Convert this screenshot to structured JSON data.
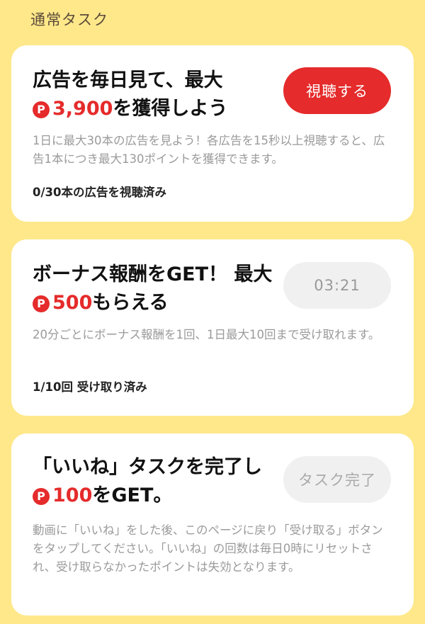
{
  "section": {
    "title": "通常タスク"
  },
  "colors": {
    "background": "#FEE88A",
    "accent": "#e52b2b",
    "card": "#ffffff"
  },
  "tasks": [
    {
      "head_line1": "広告を毎日見て、最大",
      "coin_icon": "P",
      "points": "3,900",
      "head_suffix": "を獲得しよう",
      "button": "視聴する",
      "description": "1日に最大30本の広告を見よう！各広告を15秒以上視聴すると、広告1本につき最大130ポイントを獲得できます。",
      "status": "0/30本の広告を視聴済み"
    },
    {
      "head_line1": "ボーナス報酬をGET！ 最大",
      "coin_icon": "P",
      "points": "500",
      "head_suffix": "もらえる",
      "button": "03:21",
      "description": "20分ごとにボーナス報酬を1回、1日最大10回まで受け取れます。",
      "status": "1/10回 受け取り済み"
    },
    {
      "head_line1": "「いいね」タスクを完了し",
      "coin_icon": "P",
      "points": "100",
      "head_suffix": "をGET。",
      "button": "タスク完了",
      "description": "動画に「いいね」をした後、このページに戻り「受け取る」ボタンをタップしてください。「いいね」の回数は毎日0時にリセットされ、受け取らなかったポイントは失効となります。"
    }
  ]
}
